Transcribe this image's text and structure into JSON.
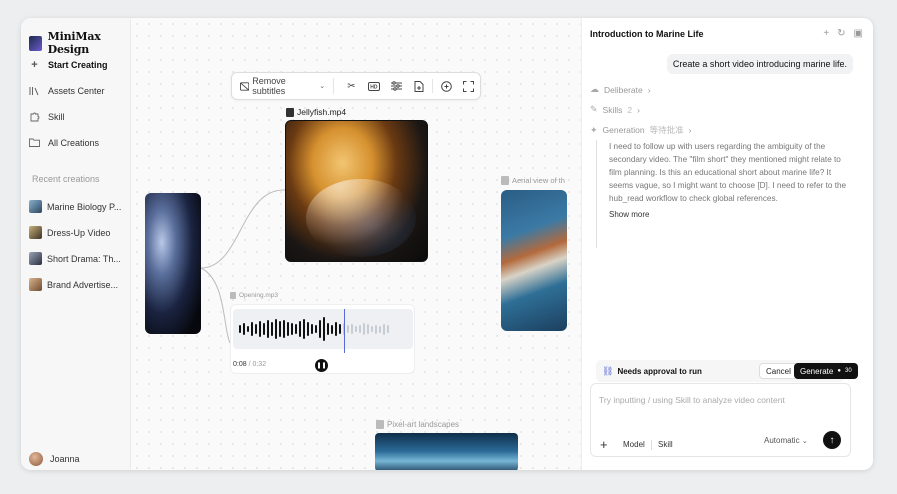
{
  "sidebar": {
    "brand": "MiniMax Design",
    "nav": [
      {
        "label": "Start Creating",
        "icon": "plus-icon"
      },
      {
        "label": "Assets Center",
        "icon": "library-icon"
      },
      {
        "label": "Skill",
        "icon": "puzzle-icon"
      },
      {
        "label": "All Creations",
        "icon": "folder-icon"
      }
    ],
    "recent_title": "Recent creations",
    "recent": [
      {
        "label": "Marine Biology P...",
        "color": "#3b5a78"
      },
      {
        "label": "Dress-Up Video",
        "color": "#6b5a3a"
      },
      {
        "label": "Short Drama: Th...",
        "color": "#4a4f5e"
      },
      {
        "label": "Brand Advertise...",
        "color": "#8a6a4a"
      }
    ],
    "user": "Joanna"
  },
  "canvas": {
    "toolbar": {
      "remove_subtitles": "Remove subtitles",
      "icons": [
        "scissors-icon",
        "hd-icon",
        "adjust-icon",
        "file-export-icon",
        "comment-icon",
        "fullscreen-icon"
      ]
    },
    "jellyfish_label": "Jellyfish.mp4",
    "aerial_label": "Aerial view of th",
    "audio_label": "Opening.mp3",
    "audio_current": "0:08",
    "audio_total": "/ 0:32",
    "pixel_label": "Pixel-art landscapes"
  },
  "panel": {
    "title": "Introduction to Marine Life",
    "user_message": "Create a short video introducing marine life.",
    "steps": [
      {
        "label": "Deliberate",
        "sub": "",
        "icon": "brain-icon"
      },
      {
        "label": "Skills",
        "sub": "2",
        "icon": "pen-icon"
      },
      {
        "label": "Generation",
        "sub": "等待批准",
        "icon": "sparkle-icon"
      }
    ],
    "reasoning": "I need to follow up with users regarding the ambiguity of the secondary video. The \"film short\" they mentioned might relate to film planning. Is this an educational short about marine life? It seems vague, so I might want to choose [D]. I need to refer to the hub_read workflow to check global references.",
    "show_more": "Show more",
    "approval": {
      "text": "Needs approval to run",
      "cancel": "Cancel",
      "generate": "Generate",
      "credits": "30"
    },
    "composer": {
      "placeholder": "Try inputting / using Skill to analyze video content",
      "model": "Model",
      "skill": "Skill",
      "mode": "Automatic"
    }
  },
  "colors": {
    "accent": "#5b6bd6",
    "primary_button": "#111111"
  }
}
